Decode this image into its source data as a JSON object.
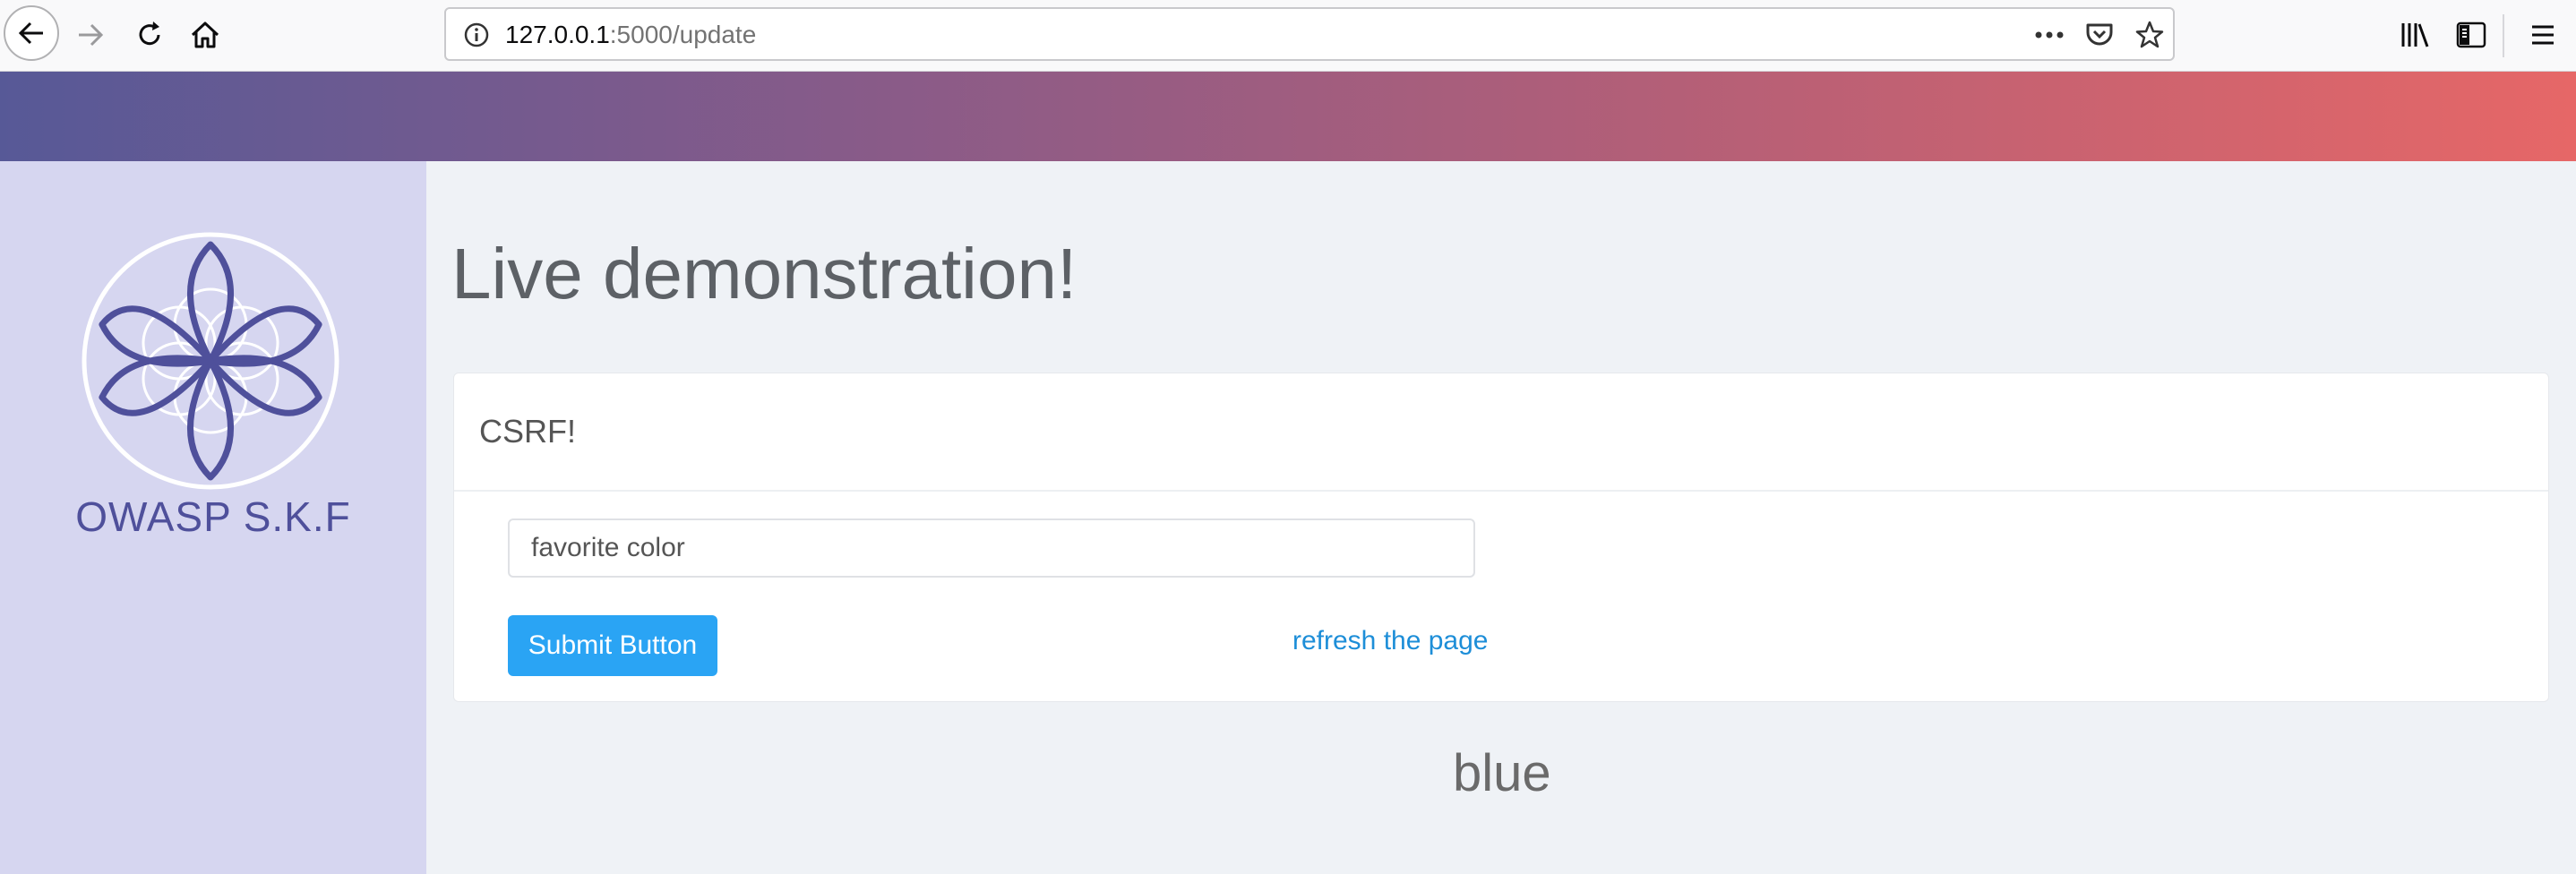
{
  "browser": {
    "url_host": "127.0.0.1",
    "url_rest": ":5000/update"
  },
  "sidebar": {
    "brand": "OWASP S.K.F"
  },
  "main": {
    "title": "Live demonstration!",
    "card_title": "CSRF!",
    "input_placeholder": "favorite color",
    "submit_label": "Submit Button",
    "refresh_link": "refresh the page",
    "result_text": "blue"
  },
  "colors": {
    "banner_start": "#575997",
    "banner_end": "#e66767",
    "sidebar_bg": "#d6d6f0",
    "brand": "#4f509b",
    "button": "#2aa4f4",
    "link": "#1d8ed8"
  }
}
